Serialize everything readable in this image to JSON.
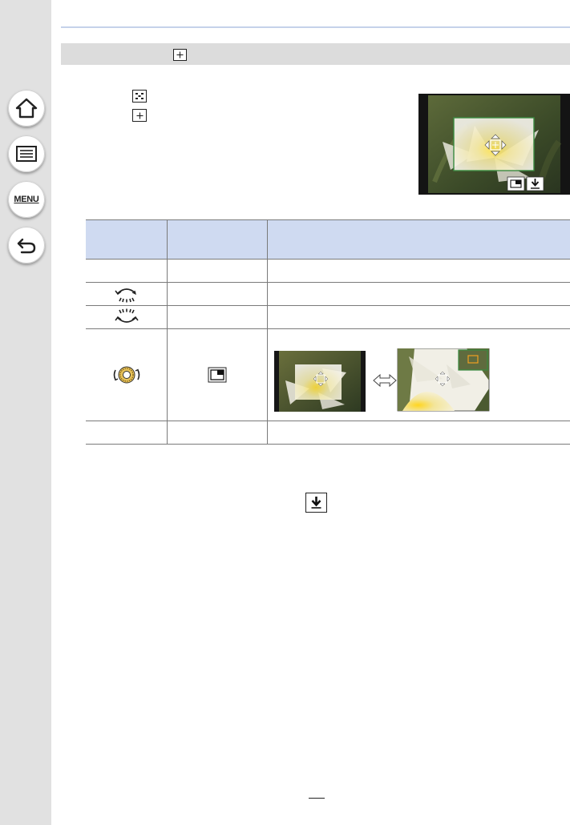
{
  "sidebar": {
    "items": [
      {
        "name": "home",
        "icon": "home-icon"
      },
      {
        "name": "contents",
        "icon": "list-icon"
      },
      {
        "name": "menu",
        "label": "MENU"
      },
      {
        "name": "back",
        "icon": "back-arrow-icon"
      }
    ]
  },
  "table": {
    "columns": [
      "",
      "",
      ""
    ],
    "rows": [
      {
        "control": "",
        "button": "",
        "description": ""
      },
      {
        "control": "rear-dial-left-icon",
        "button": "",
        "description": ""
      },
      {
        "control": "rear-dial-right-icon",
        "button": "",
        "description": ""
      },
      {
        "control": "control-dial-icon",
        "button": "picture-in-picture-icon",
        "description": ""
      },
      {
        "control": "",
        "button": "",
        "description": ""
      }
    ]
  },
  "colors": {
    "sidebar_bg": "#e1e1e1",
    "section_bar": "#dcdcdc",
    "table_header": "#cfdaf1",
    "top_rule": "#c5d2ea",
    "guide_frame": "#3a8a40",
    "zoom_frame": "#f0a020"
  }
}
